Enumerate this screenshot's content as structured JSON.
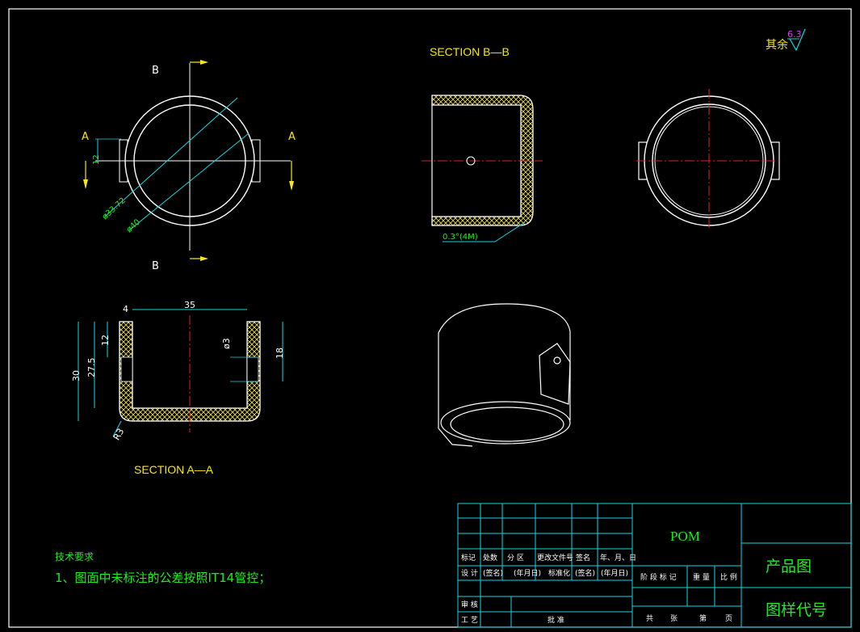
{
  "views": {
    "section_aa": {
      "title": "SECTION A—A"
    },
    "section_bb": {
      "title": "SECTION B—B"
    },
    "top_view": {
      "cut_a_left": "A",
      "cut_a_right": "A",
      "cut_b_top": "B",
      "cut_b_bottom": "B"
    }
  },
  "dimensions": {
    "d_35": "35",
    "d_4": "4",
    "d_30": "30",
    "d_27_5": "27.5",
    "d_12a": "12",
    "d_18": "18",
    "d_phi3": "ø3",
    "d_r3": "R3",
    "d_12b": "12",
    "d_phi33": "ø33.72",
    "d_phi40": "ø40",
    "d_wall": "0.3°(4M)"
  },
  "surface_finish": {
    "label": "其余",
    "value": "6.3"
  },
  "notes": {
    "heading": "技术要求",
    "item1": "1、图面中未标注的公差按照IT14管控；"
  },
  "title_block": {
    "material": "POM",
    "drawing_name": "产品图",
    "drawing_code": "图样代号",
    "row_headers": [
      "标记",
      "处数",
      "分 区",
      "更改文件号",
      "签名",
      "年、月、日"
    ],
    "design_row": [
      "设 计",
      "(签名)",
      "(年月日)",
      "标准化",
      "(签名)",
      "(年月日)"
    ],
    "review": "审 核",
    "process": "工 艺",
    "approve": "批 准",
    "stage_row": [
      "阶 段 标 记",
      "重 量",
      "比 例"
    ],
    "sheet_row": [
      "共",
      "张",
      "第",
      "页"
    ]
  }
}
